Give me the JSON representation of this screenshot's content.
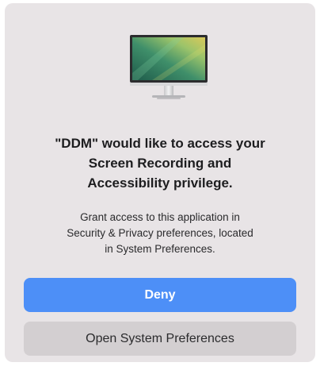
{
  "dialog": {
    "icon": "display-monitor-icon",
    "title": "\"DDM\" would like to access your\nScreen Recording and\nAccessibility privilege.",
    "message": "Grant access to this application in\nSecurity & Privacy preferences, located\nin System Preferences.",
    "buttons": {
      "deny_label": "Deny",
      "open_prefs_label": "Open System Preferences"
    }
  },
  "colors": {
    "dialog_background": "#e8e4e6",
    "primary_button": "#4d8ff7",
    "secondary_button": "#d3cfd1"
  }
}
